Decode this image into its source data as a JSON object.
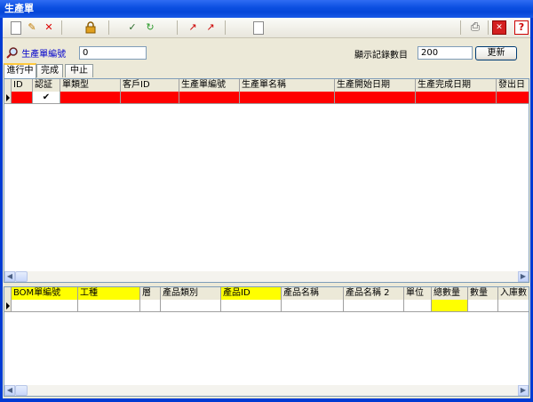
{
  "window": {
    "title": "生產單"
  },
  "toolbar": {
    "buttons": [
      {
        "name": "new-icon",
        "glyph": ""
      },
      {
        "name": "edit-pencil-icon",
        "glyph": "✎"
      },
      {
        "name": "delete-icon",
        "glyph": "✕"
      },
      {
        "name": "lock-icon",
        "glyph": "🔒"
      },
      {
        "name": "check-doc-icon",
        "glyph": "✓"
      },
      {
        "name": "recycle-icon",
        "glyph": "↻"
      },
      {
        "name": "export-icon",
        "glyph": "↗"
      },
      {
        "name": "export2-icon",
        "glyph": "↗"
      },
      {
        "name": "copy-doc-icon",
        "glyph": ""
      },
      {
        "name": "print-icon",
        "glyph": "⎙"
      },
      {
        "name": "close-icon",
        "glyph": "✕"
      },
      {
        "name": "help-icon",
        "glyph": "?"
      }
    ]
  },
  "filter": {
    "order_no_label": "生產單編號",
    "order_no_value": "0",
    "count_label": "顯示記錄數目",
    "count_value": "200",
    "refresh_label": "更新"
  },
  "tabs": [
    "進行中",
    "完成",
    "中止"
  ],
  "main_grid": {
    "columns": [
      "ID",
      "認証",
      "單類型",
      "客戶ID",
      "生產單編號",
      "生產單名稱",
      "生產開始日期",
      "生產完成日期",
      "發出日"
    ],
    "row_check": "✔"
  },
  "bom_grid": {
    "columns": [
      "BOM單編號",
      "工種",
      "層",
      "產品類別",
      "產品ID",
      "產品名稱",
      "產品名稱 2",
      "單位",
      "總數量",
      "數量",
      "入庫數"
    ]
  },
  "colors": {
    "selected_row": "#ff0000",
    "highlight_col": "#ffff00",
    "titlebar": "#0a4ee0"
  }
}
